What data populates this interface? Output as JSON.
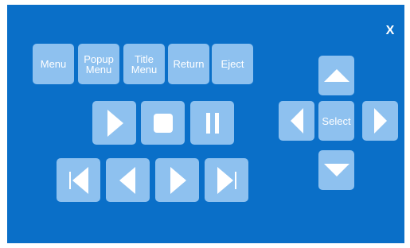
{
  "window": {
    "close_label": "X"
  },
  "menu_buttons": {
    "menu": "Menu",
    "popup_line1": "Popup",
    "popup_line2": "Menu",
    "title_line1": "Title",
    "title_line2": "Menu",
    "return": "Return",
    "eject": "Eject"
  },
  "transport": {
    "play_icon": "play-icon",
    "stop_icon": "stop-icon",
    "pause_icon": "pause-icon",
    "skip_back_icon": "skip-back-icon",
    "rewind_icon": "rewind-icon",
    "forward_icon": "forward-icon",
    "skip_forward_icon": "skip-forward-icon"
  },
  "dpad": {
    "select_label": "Select",
    "up_icon": "arrow-up-icon",
    "down_icon": "arrow-down-icon",
    "left_icon": "arrow-left-icon",
    "right_icon": "arrow-right-icon"
  },
  "colors": {
    "background": "#0a6fc8",
    "button": "#8ec1ef",
    "foreground": "#ffffff"
  }
}
